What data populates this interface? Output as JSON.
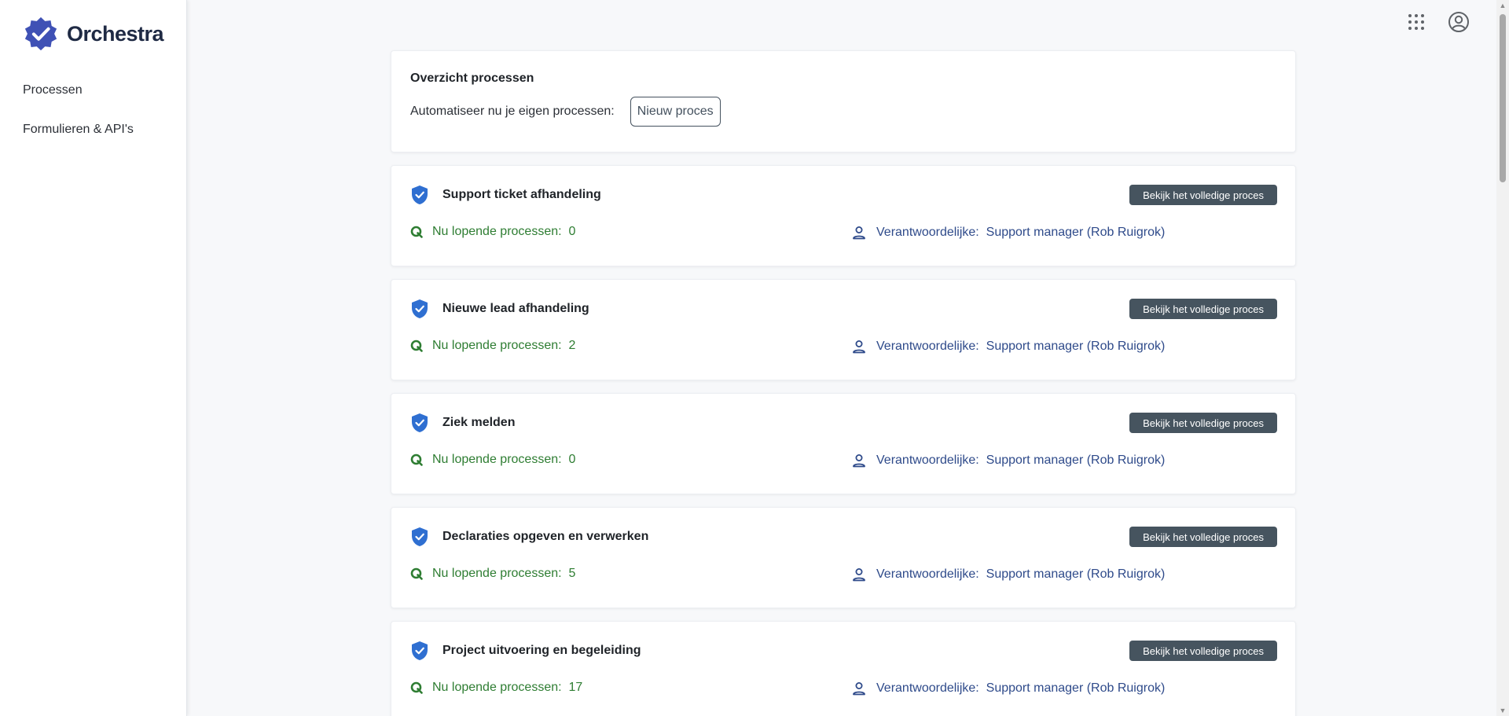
{
  "app": {
    "name": "Orchestra"
  },
  "sidebar": {
    "items": [
      {
        "label": "Processen"
      },
      {
        "label": "Formulieren & API's"
      }
    ]
  },
  "topbar": {
    "icons": [
      "apps-grid-icon",
      "account-icon"
    ]
  },
  "overview": {
    "title": "Overzicht processen",
    "cta_text": "Automatiseer nu je eigen processen:",
    "new_button_label": "Nieuw proces"
  },
  "processes": [
    {
      "title": "Support ticket afhandeling",
      "view_label": "Bekijk het volledige proces",
      "running_label": "Nu lopende processen:",
      "running_count": "0",
      "owner_label": "Verantwoordelijke:",
      "owner_value": "Support manager (Rob Ruigrok)"
    },
    {
      "title": "Nieuwe lead afhandeling",
      "view_label": "Bekijk het volledige proces",
      "running_label": "Nu lopende processen:",
      "running_count": "2",
      "owner_label": "Verantwoordelijke:",
      "owner_value": "Support manager (Rob Ruigrok)"
    },
    {
      "title": "Ziek melden",
      "view_label": "Bekijk het volledige proces",
      "running_label": "Nu lopende processen:",
      "running_count": "0",
      "owner_label": "Verantwoordelijke:",
      "owner_value": "Support manager (Rob Ruigrok)"
    },
    {
      "title": "Declaraties opgeven en verwerken",
      "view_label": "Bekijk het volledige proces",
      "running_label": "Nu lopende processen:",
      "running_count": "5",
      "owner_label": "Verantwoordelijke:",
      "owner_value": "Support manager (Rob Ruigrok)"
    },
    {
      "title": "Project uitvoering en begeleiding",
      "view_label": "Bekijk het volledige proces",
      "running_label": "Nu lopende processen:",
      "running_count": "17",
      "owner_label": "Verantwoordelijke:",
      "owner_value": "Support manager (Rob Ruigrok)"
    }
  ],
  "colors": {
    "brand": "#3f51b5",
    "running": "#2e7d32",
    "owner": "#2e4a8a",
    "view_button": "#46545f",
    "shield": "#2f6fd1"
  }
}
